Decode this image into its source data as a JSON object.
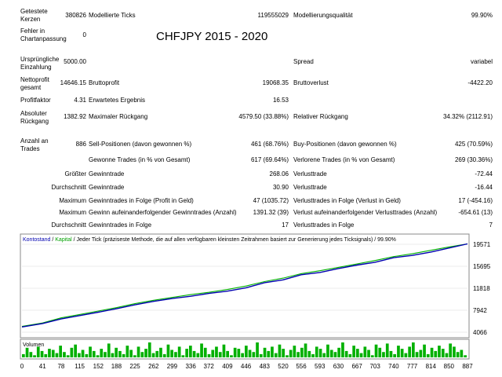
{
  "title": "CHFJPY 2015 - 2020",
  "stats": {
    "bars": {
      "label": "Getestete Kerzen",
      "value": "380826"
    },
    "ticks": {
      "label": "Modellierte Ticks",
      "value": "119555029"
    },
    "quality": {
      "label": "Modellierungsqualität",
      "value": "99.90%"
    },
    "errors": {
      "label": "Fehler in Chartanpassung",
      "value": "0"
    },
    "deposit": {
      "label": "Ursprüngliche Einzahlung",
      "value": "5000.00"
    },
    "spread": {
      "label": "Spread",
      "value": "variabel"
    },
    "net_profit": {
      "label": "Nettoprofit gesamt",
      "value": "14646.15"
    },
    "gross_profit": {
      "label": "Bruttoprofit",
      "value": "19068.35"
    },
    "gross_loss": {
      "label": "Bruttoverlust",
      "value": "-4422.20"
    },
    "profit_factor": {
      "label": "Profitfaktor",
      "value": "4.31"
    },
    "expected_payoff": {
      "label": "Erwartetes Ergebnis",
      "value": "16.53"
    },
    "abs_drawdown": {
      "label": "Absoluter Rückgang",
      "value": "1382.92"
    },
    "max_drawdown": {
      "label": "Maximaler Rückgang",
      "value": "4579.50 (33.88%)"
    },
    "rel_drawdown": {
      "label": "Relativer Rückgang",
      "value": "34.32% (2112.91)"
    },
    "total_trades": {
      "label": "Anzahl an Trades",
      "value": "886"
    },
    "short_positions": {
      "label": "Sell-Positionen (davon gewonnen %)",
      "value": "461 (68.76%)"
    },
    "long_positions": {
      "label": "Buy-Positionen (davon gewonnen %)",
      "value": "425 (70.59%)"
    },
    "profit_trades": {
      "label": "Gewonne Trades (in % von Gesamt)",
      "value": "617 (69.64%)"
    },
    "loss_trades": {
      "label": "Verlorene Trades (in % von Gesamt)",
      "value": "269 (30.36%)"
    },
    "largest_profit": {
      "prefix": "Größter",
      "label": "Gewinntrade",
      "value": "268.06"
    },
    "largest_loss": {
      "label": "Verlusttrade",
      "value": "-72.44"
    },
    "avg_profit": {
      "prefix": "Durchschnitt",
      "label": "Gewinntrade",
      "value": "30.90"
    },
    "avg_loss": {
      "label": "Verlusttrade",
      "value": "-16.44"
    },
    "max_cons_wins": {
      "prefix": "Maximum",
      "label": "Gewinntrades in Folge (Profit in Geld)",
      "value": "47 (1035.72)"
    },
    "max_cons_losses": {
      "label": "Verlusttrades in Folge (Verlust in Geld)",
      "value": "17 (-454.16)"
    },
    "max_cons_profit": {
      "prefix": "Maximum",
      "label": "Gewinn aufeinanderfolgender Gewinntrades (Anzahl)",
      "value": "1391.32 (39)"
    },
    "max_cons_loss": {
      "label": "Verlust aufeinanderfolgender Verlusttrades (Anzahl)",
      "value": "-654.61 (13)"
    },
    "avg_cons_wins": {
      "prefix": "Durchschnitt",
      "label": "Gewinntrades in Folge",
      "value": "17"
    },
    "avg_cons_losses": {
      "label": "Verlusttrades in Folge",
      "value": "7"
    }
  },
  "chart_legend": {
    "balance": "Kontostand",
    "sep1": " / ",
    "equity": "Kapital",
    "description": " / Jeder Tick (präziseste Methode, die auf allen verfügbaren kleinsten Zeitrahmen basiert zur Generierung jedes Ticksignals) / 99.90%"
  },
  "volume_label": "Volumen",
  "colors": {
    "balance": "#0000b0",
    "equity": "#00b000",
    "volume": "#00b000",
    "border": "#888888"
  },
  "chart_data": {
    "type": "line",
    "x": [
      0,
      41,
      78,
      115,
      152,
      188,
      225,
      262,
      299,
      336,
      372,
      409,
      446,
      483,
      520,
      556,
      593,
      630,
      667,
      703,
      740,
      777,
      814,
      850,
      887
    ],
    "x_tick_labels": [
      "0",
      "41",
      "78",
      "115",
      "152",
      "188",
      "225",
      "262",
      "299",
      "336",
      "372",
      "409",
      "446",
      "483",
      "520",
      "556",
      "593",
      "630",
      "667",
      "703",
      "740",
      "777",
      "814",
      "850",
      "887"
    ],
    "y_tick_labels": [
      "19571",
      "15695",
      "11818",
      "7942",
      "4066"
    ],
    "ylim": [
      4066,
      19571
    ],
    "xlim": [
      0,
      887
    ],
    "series": [
      {
        "name": "Kontostand",
        "values": [
          5000,
          5600,
          6400,
          7000,
          7600,
          8200,
          8900,
          9500,
          10000,
          10400,
          10900,
          11300,
          11900,
          12800,
          13300,
          14200,
          14600,
          15300,
          15900,
          16400,
          17200,
          17600,
          18200,
          18900,
          19646
        ]
      },
      {
        "name": "Kapital",
        "values": [
          5100,
          5700,
          6600,
          7200,
          7800,
          8400,
          9100,
          9700,
          10200,
          10700,
          11100,
          11600,
          12200,
          13000,
          13600,
          14400,
          14900,
          15500,
          16100,
          16700,
          17400,
          17900,
          18500,
          19100,
          19646
        ]
      }
    ],
    "volume": [
      3,
      9,
      5,
      2,
      10,
      6,
      3,
      8,
      7,
      4,
      11,
      5,
      2,
      9,
      12,
      4,
      7,
      3,
      10,
      6,
      2,
      8,
      5,
      13,
      4,
      9,
      6,
      3,
      11,
      7,
      2,
      10,
      5,
      8,
      14,
      4,
      6,
      9,
      3,
      12,
      7,
      5,
      10,
      2,
      8,
      11,
      6,
      4,
      13,
      9,
      3,
      7,
      10,
      5,
      12,
      6,
      2,
      9,
      8,
      4,
      11,
      7,
      5,
      14,
      3,
      9,
      6,
      10,
      4,
      12,
      8,
      2,
      7,
      11,
      5,
      9,
      13,
      6,
      3,
      10,
      8,
      4,
      12,
      7,
      5,
      9,
      14,
      6,
      3,
      11,
      8,
      4,
      10,
      7,
      2,
      12,
      9,
      5,
      13,
      6,
      3,
      11,
      8,
      4,
      10,
      14,
      5,
      7,
      12,
      3,
      9,
      6,
      11,
      8,
      4,
      13,
      10,
      5,
      7,
      2
    ]
  }
}
